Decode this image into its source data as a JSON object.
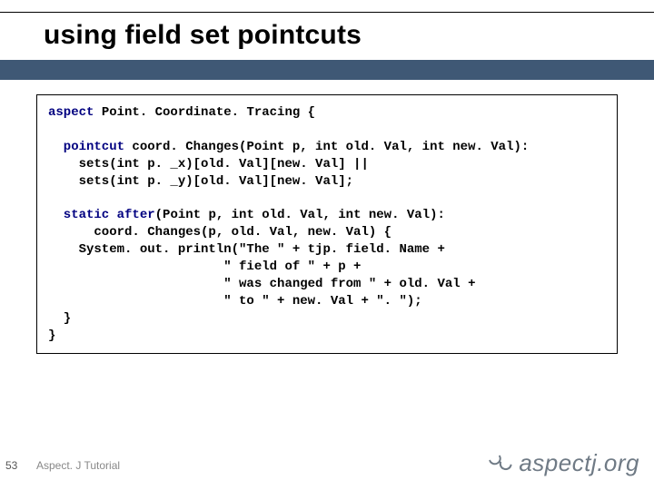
{
  "slide": {
    "title": "using field set pointcuts",
    "page_number": "53",
    "footer": "Aspect. J Tutorial",
    "logo_text": "aspectj.org"
  },
  "code": {
    "k_aspect": "aspect",
    "aspect_decl_rest": " Point. Coordinate. Tracing {",
    "blank1": "",
    "k_pointcut": "  pointcut",
    "pc_sig": " coord. Changes(Point p, int old. Val, int new. Val):",
    "pc_l1": "    sets(int p. _x)[old. Val][new. Val] ||",
    "pc_l2": "    sets(int p. _y)[old. Val][new. Val];",
    "blank2": "",
    "k_static": "  static",
    "k_after": " after",
    "adv_sig": "(Point p, int old. Val, int new. Val):",
    "adv_l2": "      coord. Changes(p, old. Val, new. Val) {",
    "adv_l3": "    System. out. println(\"The \" + tjp. field. Name +",
    "adv_l4": "                       \" field of \" + p +",
    "adv_l5": "                       \" was changed from \" + old. Val +",
    "adv_l6": "                       \" to \" + new. Val + \". \");",
    "adv_l7": "  }",
    "close": "}"
  }
}
